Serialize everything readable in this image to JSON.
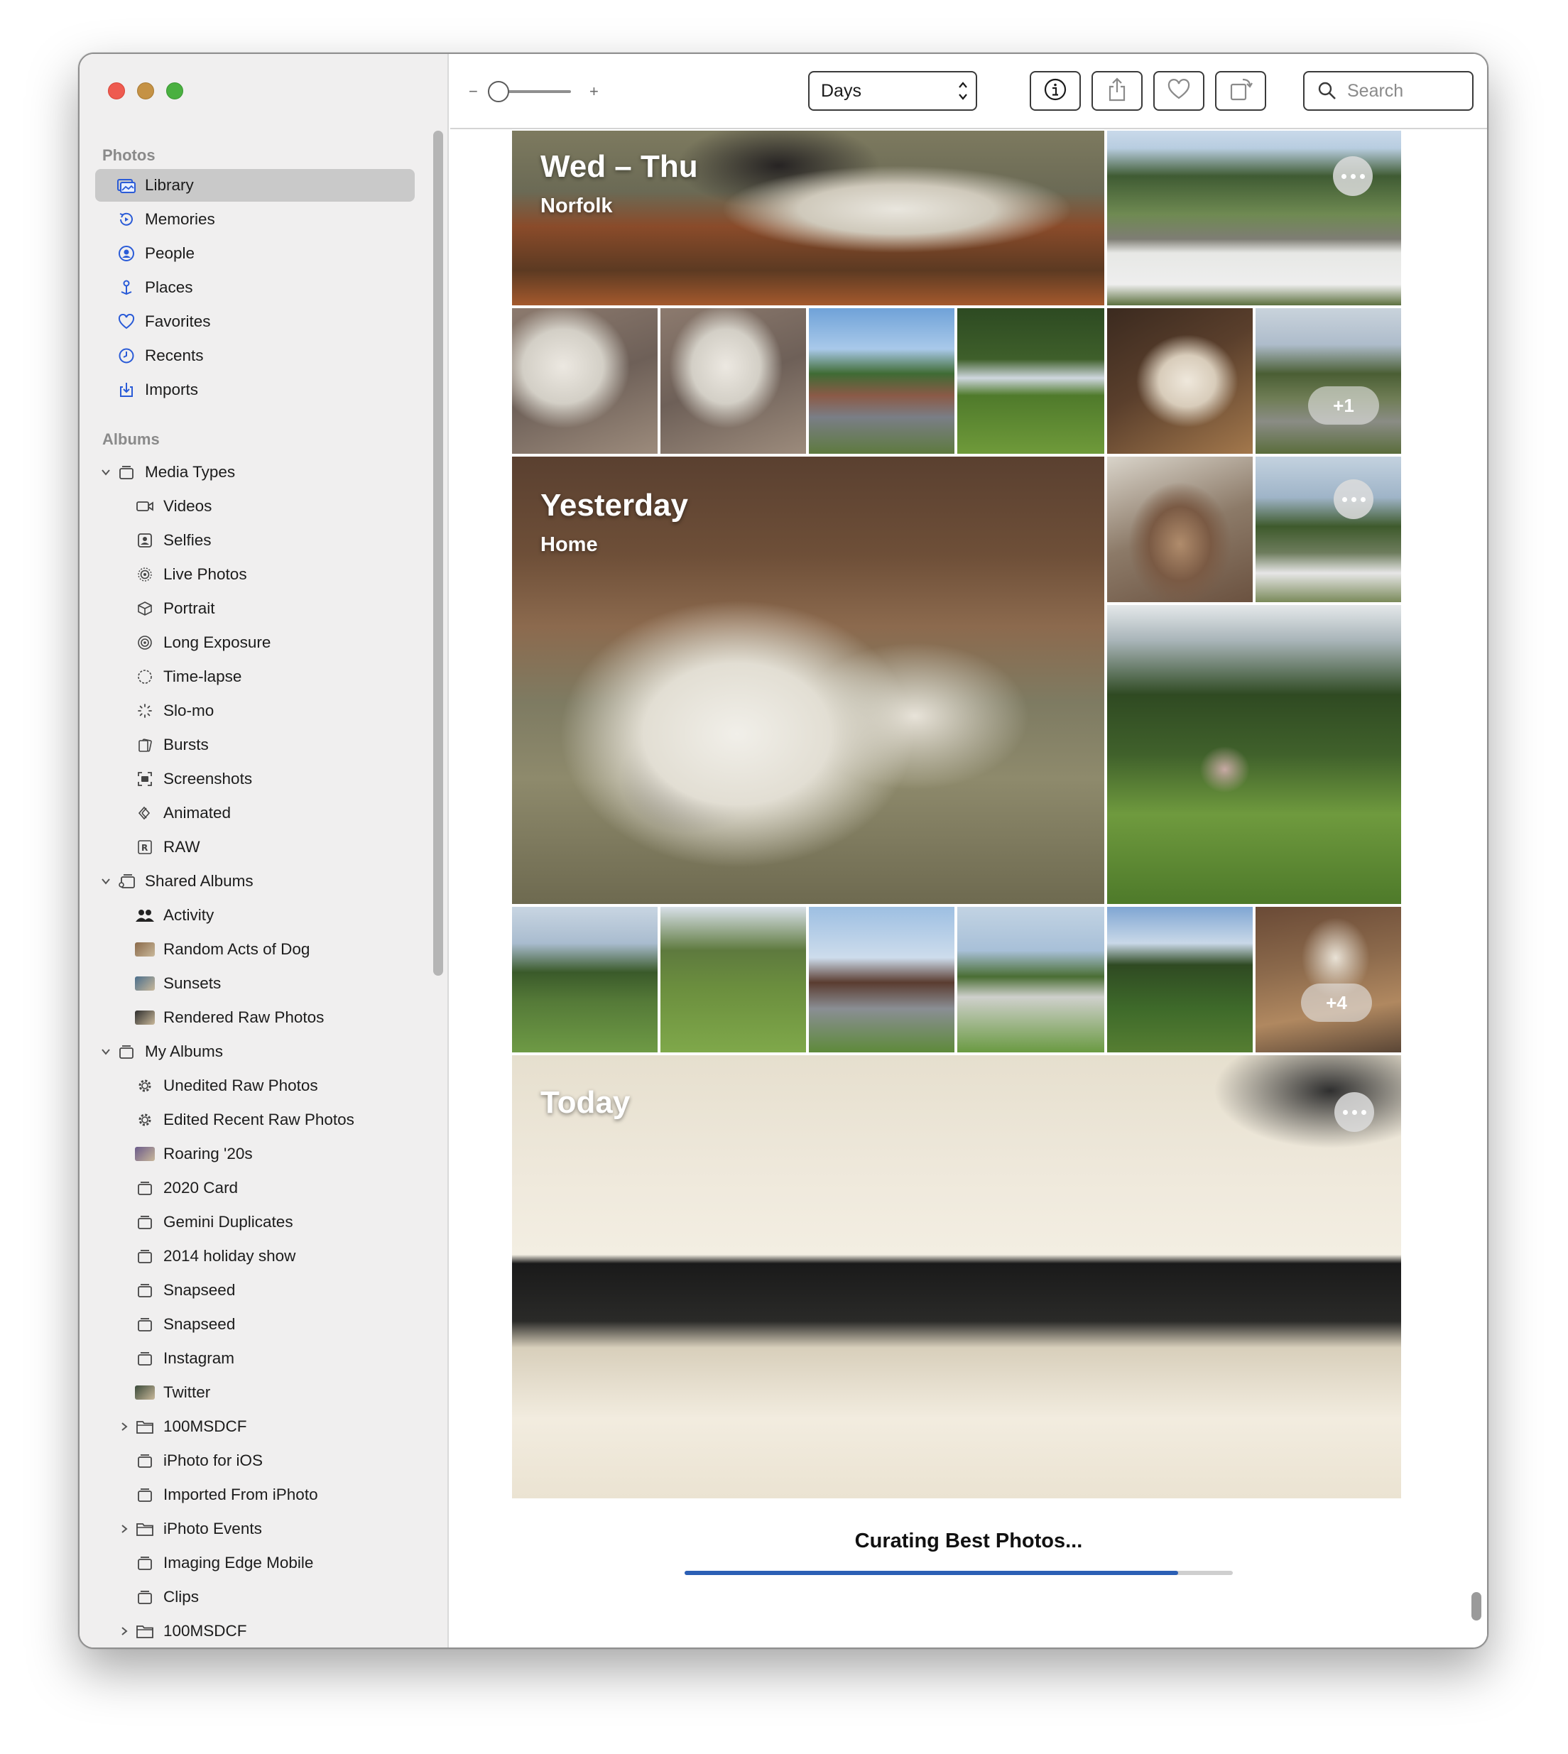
{
  "window": {
    "traffic_lights": [
      "close",
      "minimize",
      "zoom"
    ]
  },
  "sidebar": {
    "photos_header": "Photos",
    "photos_items": [
      {
        "label": "Library",
        "icon": "library-icon",
        "selected": true
      },
      {
        "label": "Memories",
        "icon": "memories-icon"
      },
      {
        "label": "People",
        "icon": "people-icon"
      },
      {
        "label": "Places",
        "icon": "places-icon"
      },
      {
        "label": "Favorites",
        "icon": "heart-icon"
      },
      {
        "label": "Recents",
        "icon": "clock-icon"
      },
      {
        "label": "Imports",
        "icon": "import-icon"
      }
    ],
    "albums_header": "Albums",
    "album_tree": [
      {
        "label": "Media Types",
        "level": 0,
        "expander": "expanded",
        "icon": "folder-stack-icon"
      },
      {
        "label": "Videos",
        "level": 1,
        "icon": "video-icon"
      },
      {
        "label": "Selfies",
        "level": 1,
        "icon": "selfie-icon"
      },
      {
        "label": "Live Photos",
        "level": 1,
        "icon": "live-photo-icon"
      },
      {
        "label": "Portrait",
        "level": 1,
        "icon": "portrait-cube-icon"
      },
      {
        "label": "Long Exposure",
        "level": 1,
        "icon": "long-exposure-icon"
      },
      {
        "label": "Time-lapse",
        "level": 1,
        "icon": "timelapse-icon"
      },
      {
        "label": "Slo-mo",
        "level": 1,
        "icon": "slomo-icon"
      },
      {
        "label": "Bursts",
        "level": 1,
        "icon": "bursts-icon"
      },
      {
        "label": "Screenshots",
        "level": 1,
        "icon": "screenshot-icon"
      },
      {
        "label": "Animated",
        "level": 1,
        "icon": "animated-icon"
      },
      {
        "label": "RAW",
        "level": 1,
        "icon": "raw-icon"
      },
      {
        "label": "Shared Albums",
        "level": 0,
        "expander": "expanded",
        "icon": "shared-album-icon"
      },
      {
        "label": "Activity",
        "level": 1,
        "icon": "activity-icon"
      },
      {
        "label": "Random Acts of Dog",
        "level": 1,
        "icon": "album-thumb-icon",
        "thumb": "#8a6a4a"
      },
      {
        "label": "Sunsets",
        "level": 1,
        "icon": "album-thumb-icon",
        "thumb": "#4a6e8c"
      },
      {
        "label": "Rendered Raw Photos",
        "level": 1,
        "icon": "album-thumb-icon",
        "thumb": "#2e2e2e"
      },
      {
        "label": "My Albums",
        "level": 0,
        "expander": "expanded",
        "icon": "folder-stack-icon"
      },
      {
        "label": "Unedited Raw Photos",
        "level": 1,
        "icon": "gear-icon"
      },
      {
        "label": "Edited Recent Raw Photos",
        "level": 1,
        "icon": "gear-icon"
      },
      {
        "label": "Roaring '20s",
        "level": 1,
        "icon": "album-thumb-icon",
        "thumb": "#6a5a8a"
      },
      {
        "label": "2020 Card",
        "level": 1,
        "icon": "album-icon"
      },
      {
        "label": "Gemini Duplicates",
        "level": 1,
        "icon": "album-icon"
      },
      {
        "label": "2014 holiday show",
        "level": 1,
        "icon": "album-icon"
      },
      {
        "label": "Snapseed",
        "level": 1,
        "icon": "album-icon"
      },
      {
        "label": "Snapseed",
        "level": 1,
        "icon": "album-icon"
      },
      {
        "label": "Instagram",
        "level": 1,
        "icon": "album-icon"
      },
      {
        "label": "Twitter",
        "level": 1,
        "icon": "album-thumb-icon",
        "thumb": "#3a4a3a"
      },
      {
        "label": "100MSDCF",
        "level": 1,
        "expander": "collapsed",
        "icon": "folder-icon"
      },
      {
        "label": "iPhoto for iOS",
        "level": 1,
        "icon": "album-icon"
      },
      {
        "label": "Imported From iPhoto",
        "level": 1,
        "icon": "album-icon"
      },
      {
        "label": "iPhoto Events",
        "level": 1,
        "expander": "collapsed",
        "icon": "folder-icon"
      },
      {
        "label": "Imaging Edge Mobile",
        "level": 1,
        "icon": "album-icon"
      },
      {
        "label": "Clips",
        "level": 1,
        "icon": "album-icon"
      },
      {
        "label": "100MSDCF",
        "level": 1,
        "expander": "collapsed",
        "icon": "folder-icon"
      }
    ]
  },
  "toolbar": {
    "zoom_minus": "−",
    "zoom_plus": "+",
    "zoom_level": 0.1,
    "view_select": "Days",
    "search_placeholder": "Search",
    "buttons": [
      "info-icon",
      "share-icon",
      "heart-icon",
      "rotate-icon"
    ]
  },
  "days": [
    {
      "title": "Wed – Thu",
      "subtitle": "Norfolk",
      "extra_count": "+1"
    },
    {
      "title": "Yesterday",
      "subtitle": "Home",
      "extra_count": "+4"
    },
    {
      "title": "Today",
      "subtitle": ""
    }
  ],
  "status": {
    "label": "Curating Best Photos...",
    "progress": 0.9
  },
  "colors": {
    "accent": "#2b5fb5",
    "selected_row": "#c9c9c9",
    "sidebar_bg": "#f0efef"
  }
}
